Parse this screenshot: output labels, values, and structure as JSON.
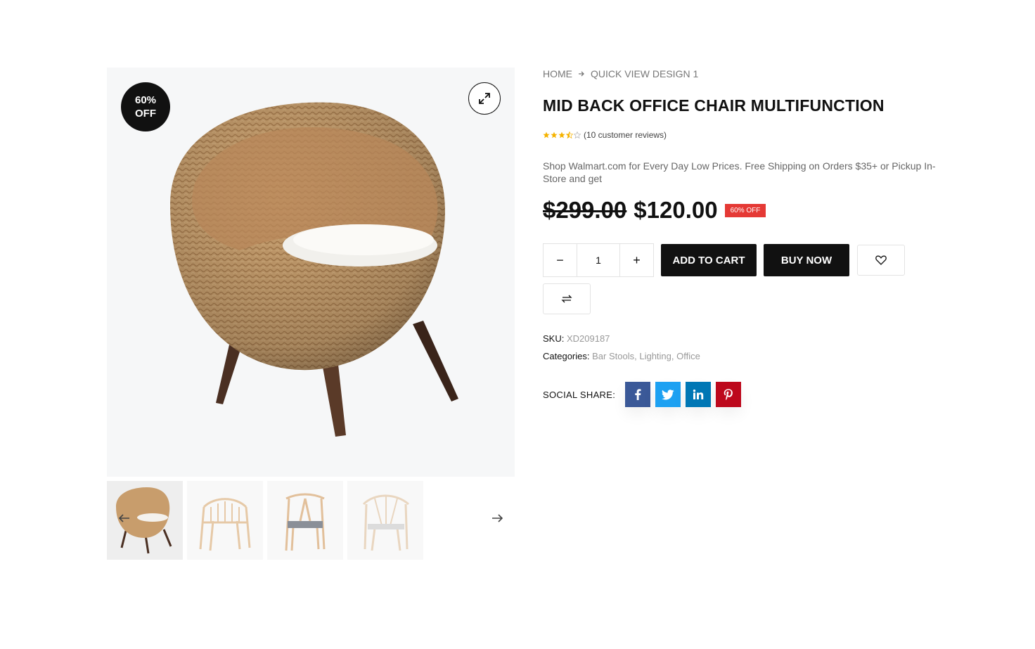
{
  "gallery": {
    "badge_line1": "60%",
    "badge_line2": "OFF",
    "zoom_icon": "expand-icon",
    "thumbnails": [
      {
        "name": "rattan-egg-chair"
      },
      {
        "name": "wooden-armchair"
      },
      {
        "name": "wishbone-chair-grey-seat"
      },
      {
        "name": "wishbone-chair-white"
      }
    ],
    "colors": {
      "background": "#f6f7f8",
      "rattan": "#c59a6a",
      "legs": "#4a2f22",
      "cushion": "#f1f0ec"
    }
  },
  "breadcrumb": {
    "home": "HOME",
    "current": "QUICK VIEW DESIGN 1"
  },
  "product": {
    "title": "MID BACK OFFICE CHAIR MULTIFUNCTION",
    "rating": 3.5,
    "reviews": "(10 customer reviews)",
    "description": "Shop Walmart.com for Every Day Low Prices. Free Shipping on Orders $35+ or Pickup In-Store and get",
    "old_price": "$299.00",
    "new_price": "$120.00",
    "off_tag": "60% OFF",
    "quantity": "1",
    "minus": "−",
    "plus": "+",
    "add_to_cart": "ADD TO CART",
    "buy_now": "BUY NOW",
    "sku_label": "SKU:",
    "sku": "XD209187",
    "categories_label": "Categories:",
    "categories": [
      "Bar Stools",
      "Lighting",
      "Office"
    ],
    "share_label": "SOCIAL SHARE:",
    "social": [
      {
        "name": "facebook",
        "color": "#3b5998"
      },
      {
        "name": "twitter",
        "color": "#1da1f2"
      },
      {
        "name": "linkedin",
        "color": "#0077b5"
      },
      {
        "name": "pinterest",
        "color": "#bd081c"
      }
    ],
    "colors": {
      "star": "#f5b301",
      "off_tag": "#e53935",
      "dark_button": "#111111"
    }
  }
}
